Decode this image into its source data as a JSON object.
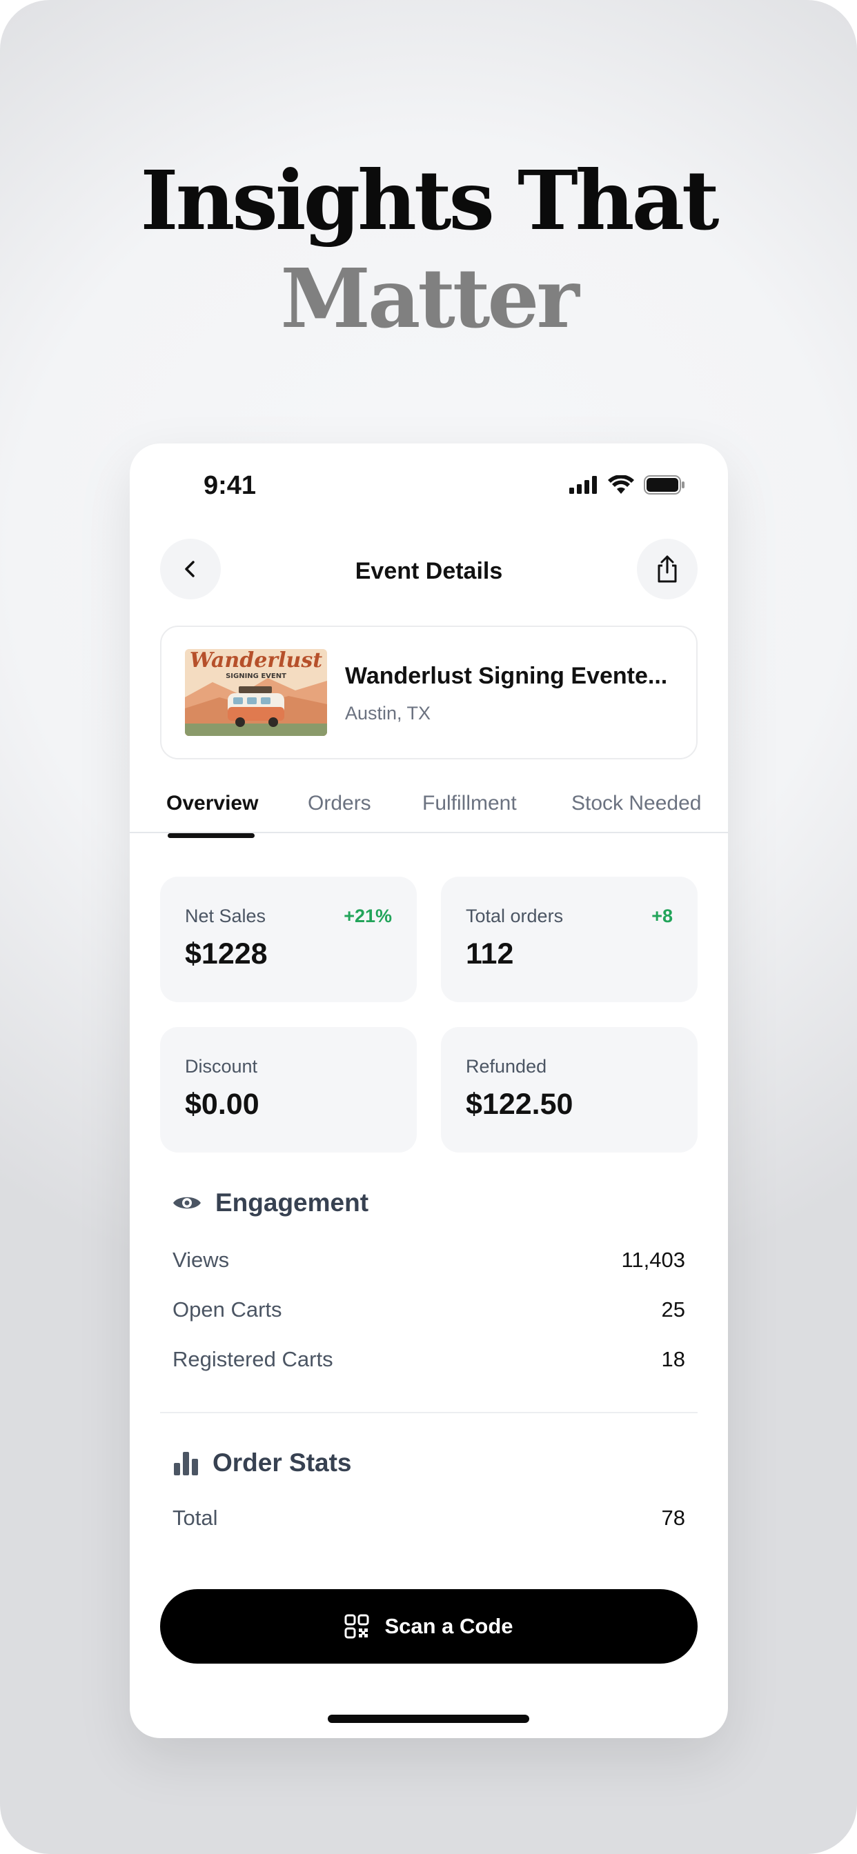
{
  "headline": {
    "line1": "Insights That",
    "line2": "Matter"
  },
  "status_bar": {
    "time": "9:41"
  },
  "nav": {
    "title": "Event Details"
  },
  "event": {
    "title": "Wanderlust Signing Evente...",
    "location": "Austin, TX",
    "thumbnail": {
      "brand": "Wanderlust",
      "tagline": "SIGNING EVENT"
    }
  },
  "tabs": [
    {
      "label": "Overview",
      "active": true
    },
    {
      "label": "Orders",
      "active": false
    },
    {
      "label": "Fulfillment",
      "active": false
    },
    {
      "label": "Stock Needed",
      "active": false
    }
  ],
  "stats": [
    {
      "label": "Net Sales",
      "value": "$1228",
      "delta": "+21%"
    },
    {
      "label": "Total orders",
      "value": "112",
      "delta": "+8"
    },
    {
      "label": "Discount",
      "value": "$0.00",
      "delta": ""
    },
    {
      "label": "Refunded",
      "value": "$122.50",
      "delta": ""
    }
  ],
  "engagement": {
    "title": "Engagement",
    "icon": "eye-icon",
    "rows": [
      {
        "label": "Views",
        "value": "11,403"
      },
      {
        "label": "Open Carts",
        "value": "25"
      },
      {
        "label": "Registered Carts",
        "value": "18"
      }
    ]
  },
  "order_stats": {
    "title": "Order Stats",
    "icon": "bar-chart-icon",
    "rows": [
      {
        "label": "Total",
        "value": "78"
      }
    ]
  },
  "cta": {
    "label": "Scan a Code",
    "icon": "qr-code-icon"
  },
  "colors": {
    "positive": "#22a45a",
    "primary": "#000000",
    "card_bg": "#f5f6f8"
  }
}
